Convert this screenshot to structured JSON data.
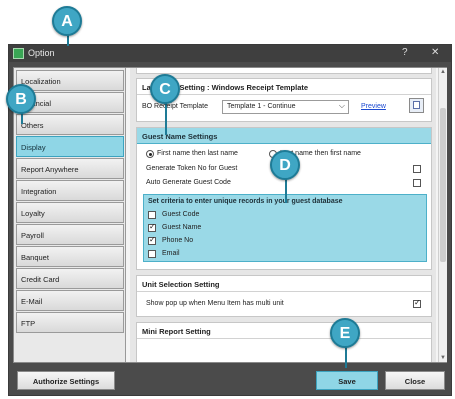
{
  "window": {
    "title": "Option",
    "help_label": "?",
    "close_label": "✕"
  },
  "sidebar": {
    "items": [
      {
        "label": "Localization"
      },
      {
        "label": "Financial"
      },
      {
        "label": "Others"
      },
      {
        "label": "Display"
      },
      {
        "label": "Report Anywhere"
      },
      {
        "label": "Integration"
      },
      {
        "label": "Loyalty"
      },
      {
        "label": "Payroll"
      },
      {
        "label": "Banquet"
      },
      {
        "label": "Credit Card"
      },
      {
        "label": "E-Mail"
      },
      {
        "label": "FTP"
      }
    ],
    "active": "Display"
  },
  "language_setting": {
    "title": "Language Setting : Windows Receipt Template",
    "bo_label": "BO Receipt Template",
    "template_value": "Template 1 - Continue",
    "preview_label": "Preview"
  },
  "guest_name": {
    "title": "Guest Name Settings",
    "radio_first_last": "First name then last name",
    "radio_last_first": "Last name then first name",
    "gen_token_label": "Generate Token No for Guest",
    "auto_code_label": "Auto Generate Guest Code",
    "criteria_title": "Set criteria to enter unique records in your guest database",
    "criteria": [
      {
        "label": "Guest Code",
        "checked": false
      },
      {
        "label": "Guest Name",
        "checked": true
      },
      {
        "label": "Phone No",
        "checked": true
      },
      {
        "label": "Email",
        "checked": false
      }
    ]
  },
  "unit_selection": {
    "title": "Unit Selection Setting",
    "popup_label": "Show pop up when Menu Item has multi unit",
    "popup_checked": true
  },
  "mini_report": {
    "title": "Mini Report Setting"
  },
  "footer": {
    "authorize_label": "Authorize Settings",
    "save_label": "Save",
    "close_label": "Close"
  },
  "callouts": {
    "a": "A",
    "b": "B",
    "c": "C",
    "d": "D",
    "e": "E"
  },
  "glyphs": {
    "check": "✓",
    "dropdown_arrow": "⌵",
    "scroll_up": "▲",
    "scroll_down": "▼"
  },
  "colors": {
    "accent": "#8fd6e6",
    "callout": "#3fa6c4",
    "titlebar": "#3f3f3f"
  }
}
